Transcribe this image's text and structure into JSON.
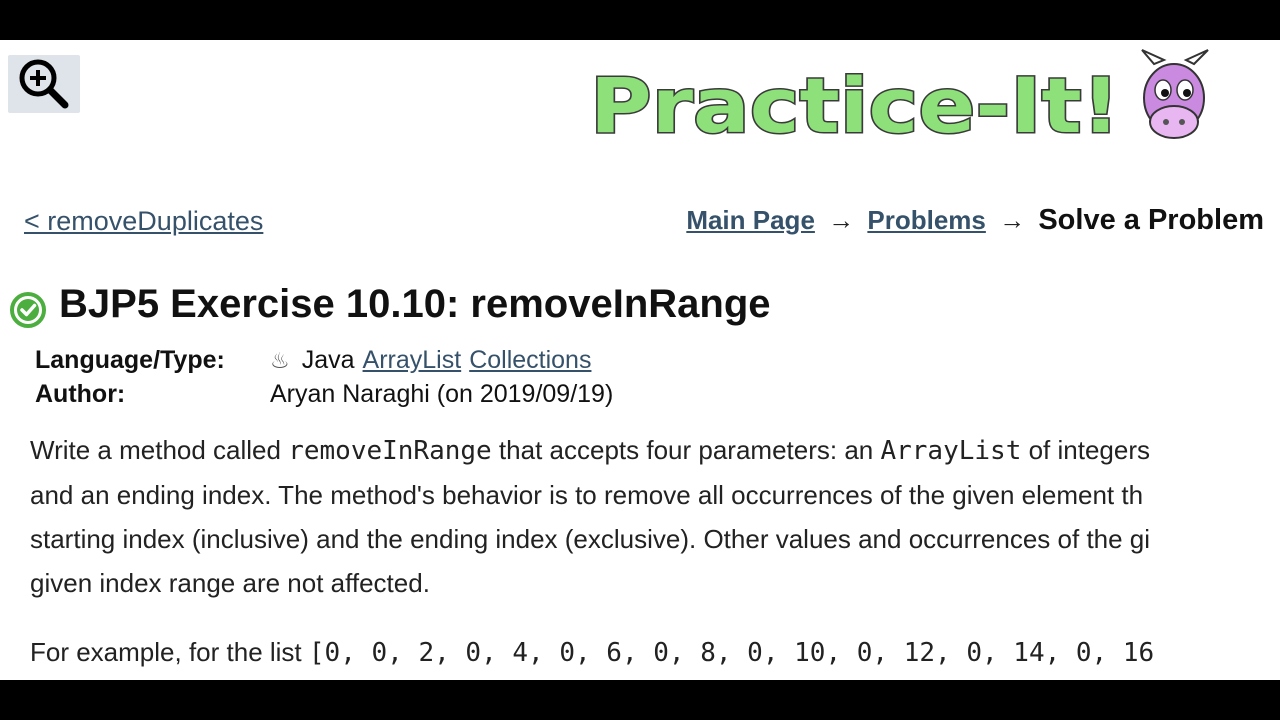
{
  "header": {
    "zoom_icon": "zoom-in-icon",
    "logo_text": "Practice-It!",
    "logo_mascot": "cow-mascot"
  },
  "nav": {
    "prev_problem": "< removeDuplicates",
    "breadcrumb": {
      "main_page": "Main Page",
      "arrow1": "→",
      "problems": "Problems",
      "arrow2": "→",
      "current": "Solve a Problem"
    }
  },
  "problem": {
    "status_icon": "check-circle-icon",
    "status_color": "#4cae3e",
    "title": "BJP5 Exercise 10.10: removeInRange",
    "language_label": "Language/Type:",
    "language_icon": "java-cup-icon",
    "language": "Java",
    "tags": [
      "ArrayList",
      "Collections"
    ],
    "author_label": "Author:",
    "author": "Aryan Naraghi (on 2019/09/19)"
  },
  "description": {
    "line1_before": "Write a method called ",
    "line1_code1": "removeInRange",
    "line1_mid": " that accepts four parameters: an ",
    "line1_code2": "ArrayList",
    "line1_after": " of integers",
    "line2": "and an ending index. The method's behavior is to remove all occurrences of the given element th",
    "line3": "starting index (inclusive) and the ending index (exclusive). Other values and occurrences of the gi",
    "line4": "given index range are not affected.",
    "example_before": "For example, for the list ",
    "example_code": "[0, 0, 2, 0, 4, 0, 6, 0, 8, 0, 10, 0, 12, 0, 14, 0, 16"
  }
}
